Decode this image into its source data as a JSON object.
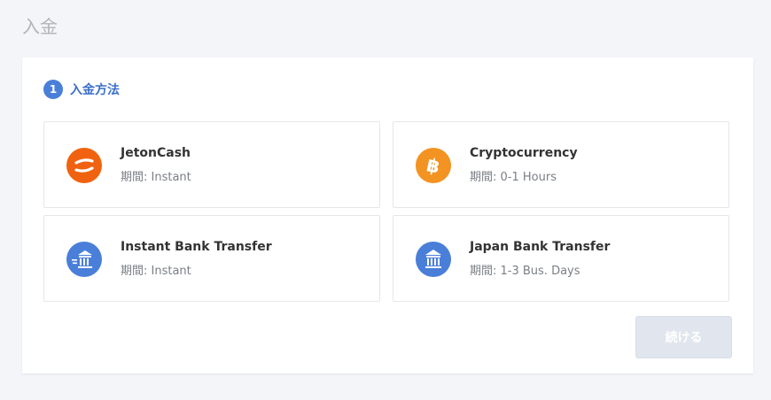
{
  "page": {
    "title": "入金"
  },
  "step": {
    "number": "1",
    "label": "入金方法"
  },
  "methods": [
    {
      "name": "JetonCash",
      "period": "期間: Instant",
      "icon": "jetoncash-icon",
      "color": "#f0620f"
    },
    {
      "name": "Cryptocurrency",
      "period": "期間: 0-1 Hours",
      "icon": "bitcoin-icon",
      "color": "#f29322"
    },
    {
      "name": "Instant Bank Transfer",
      "period": "期間: Instant",
      "icon": "instant-bank-icon",
      "color": "#4a7fd9"
    },
    {
      "name": "Japan Bank Transfer",
      "period": "期間: 1-3 Bus. Days",
      "icon": "bank-icon",
      "color": "#4a7fd9"
    }
  ],
  "actions": {
    "continue_label": "続ける"
  }
}
